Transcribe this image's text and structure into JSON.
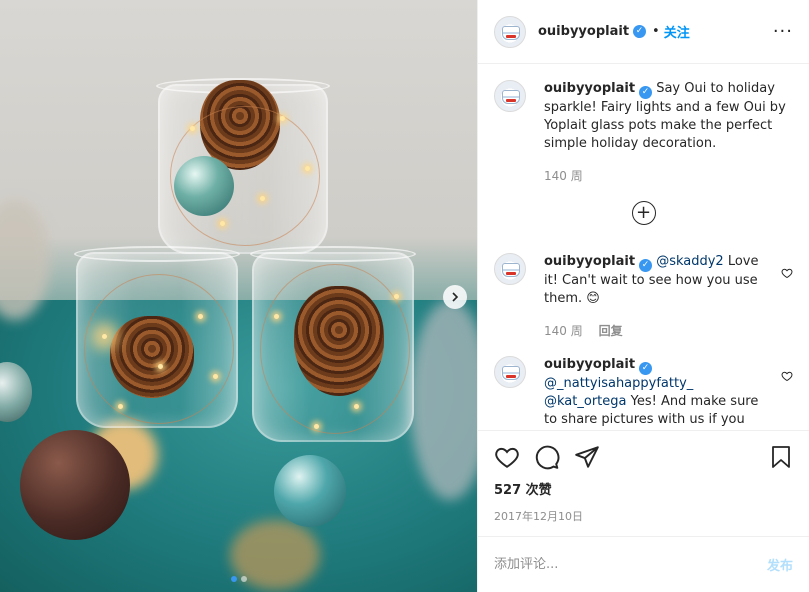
{
  "post": {
    "username": "ouibyyoplait",
    "follow_label": "关注",
    "separator": "•",
    "more_label": "···",
    "caption": {
      "username": "ouibyyoplait",
      "text": "Say Oui to holiday sparkle! Fairy lights and a few Oui by Yoplait glass pots make the perfect simple holiday decoration.",
      "age": "140 周"
    },
    "load_more_symbol": "+",
    "comments": [
      {
        "username": "ouibyyoplait",
        "mentions": [
          "@skaddy2"
        ],
        "text": "Love it! Can't wait to see how you use them. 😊",
        "age": "140 周",
        "reply_label": "回复"
      },
      {
        "username": "ouibyyoplait",
        "mentions": [
          "@_nattyisahappyfatty_",
          "@kat_ortega"
        ],
        "text": "Yes! And make sure to share pictures with us if you",
        "age": "",
        "reply_label": ""
      }
    ],
    "likes": "527 次赞",
    "date": "2017年12月10日",
    "add_comment_placeholder": "添加评论...",
    "post_label": "发布"
  },
  "colors": {
    "link_blue": "#0095f6",
    "verified_blue": "#3897f0",
    "post_disabled": "#b2dffc"
  },
  "icons": [
    "verified-badge-icon",
    "more-options-icon",
    "heart-icon",
    "comment-icon",
    "share-icon",
    "bookmark-icon",
    "plus-circle-icon",
    "chevron-right-icon"
  ],
  "carousel": {
    "slides": 2,
    "active": 1
  }
}
